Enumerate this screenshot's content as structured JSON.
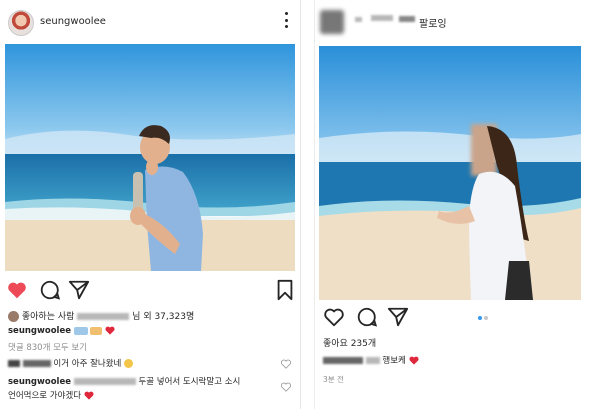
{
  "left_post": {
    "username": "seungwoolee",
    "likes_prefix": "좋아하는 사람",
    "likes_suffix": "님 외 37,323명",
    "caption_user": "seungwoolee",
    "view_comments": "댓글 830개 모두 보기",
    "comment1_text": "이거 아주 잘나왔네",
    "reply_user": "seungwoolee",
    "reply_text_1": "두골 넣어서 도시락말고 소시",
    "reply_text_2": "언어먹으로 가야겠다"
  },
  "right_post": {
    "follow_label": "팔로잉",
    "likes": "좋아요 235개",
    "caption_suffix": "행보케",
    "time": "3분 전"
  },
  "colors": {
    "like_red": "#ed4956",
    "sky_top": "#3a9fe0",
    "sea": "#1f7fb6",
    "sand": "#efe0c8"
  }
}
